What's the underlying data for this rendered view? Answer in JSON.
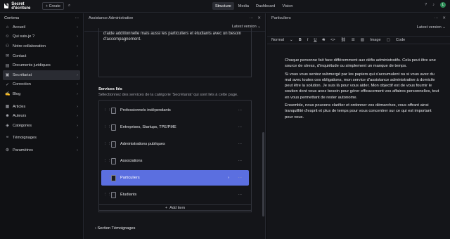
{
  "topbar": {
    "app_name": "Secret d'écriture",
    "create_label": "+ Create",
    "nav": [
      "Structure",
      "Media",
      "Dashboard",
      "Vision"
    ],
    "active_nav": "Structure",
    "avatar_letter": "L"
  },
  "sidebar": {
    "title": "Contenu",
    "groups": [
      [
        {
          "label": "Accueil",
          "icon": "home-icon"
        },
        {
          "label": "Qui suis-je ?",
          "icon": "user-icon"
        },
        {
          "label": "Notre collaboration",
          "icon": "handshake-icon"
        },
        {
          "label": "Contact",
          "icon": "mail-icon"
        },
        {
          "label": "Documents juridiques",
          "icon": "document-icon"
        },
        {
          "label": "Secrétariat",
          "icon": "folder-icon"
        },
        {
          "label": "Correction",
          "icon": "check-icon"
        },
        {
          "label": "Blog",
          "icon": "blog-icon"
        }
      ],
      [
        {
          "label": "Articles",
          "icon": "article-icon"
        },
        {
          "label": "Auteurs",
          "icon": "author-icon"
        },
        {
          "label": "Catégories",
          "icon": "category-icon"
        }
      ],
      [
        {
          "label": "Témoignages",
          "icon": "quote-icon"
        }
      ],
      [
        {
          "label": "Paramètres",
          "icon": "gear-icon"
        }
      ]
    ],
    "active": "Secrétariat"
  },
  "middle": {
    "title": "Assistance Administrative",
    "version_label": "Latest version",
    "textarea_text": "d'aide additionnelle mais aussi les particuliers et étudiants avec un besoin d'accompagnement.",
    "services_title": "Services liés",
    "services_sub": "Sélectionnez des services de la catégorie 'Secrétariat' qui sont liés à cette page.",
    "services": [
      "Professionnels indépendants",
      "Entreprises, Startups, TPE/PME",
      "Administrations publiques",
      "Associations",
      "Particuliers",
      "Étudiants"
    ],
    "active_service": "Particuliers",
    "add_item_label": "Add item",
    "section_temo": "Section Témoignages"
  },
  "right": {
    "title": "Particuliers",
    "version_label": "Latest version",
    "toolbar": {
      "style": "Normal",
      "bold": "B",
      "italic": "I",
      "underline": "U",
      "strike": "S",
      "code_inline": "<>",
      "image": "Image",
      "code": "Code"
    },
    "paragraphs": [
      "Chaque personne fait face différemment aux défis administratifs. Cela peut être une source de stress, d'inquiétude ou simplement un manque de temps.",
      "Si vous vous sentez submergé par les papiers qui s'accumulent ou si vous avez du mal avec toutes ces obligations, mon service d'assistance administrative à domicile peut être la solution. Je suis là pour vous aider. Mon objectif est de vous fournir le soutien dont vous avez besoin pour gérer efficacement vos affaires personnelles, tout en vous permettant de rester autonome.",
      "Ensemble, nous pouvons clarifier et ordonner vos démarches, vous offrant ainsi tranquillité d'esprit et plus de temps pour vous concentrer sur ce qui est important pour vous."
    ]
  },
  "colors": {
    "accent": "#5b6fe0",
    "background": "#101114"
  }
}
